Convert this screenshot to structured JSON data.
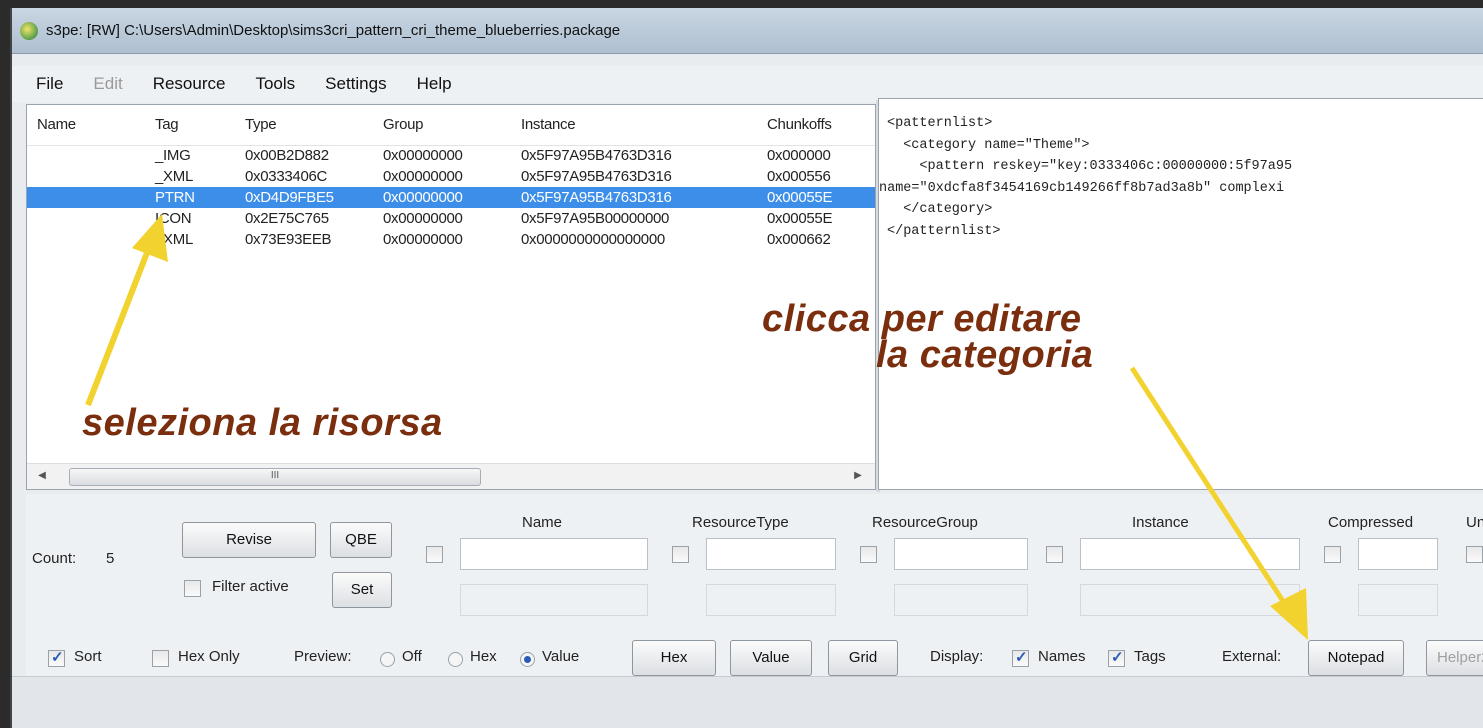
{
  "window": {
    "title": "s3pe: [RW] C:\\Users\\Admin\\Desktop\\sims3cri_pattern_cri_theme_blueberries.package"
  },
  "menu": [
    {
      "label": "File",
      "enabled": true
    },
    {
      "label": "Edit",
      "enabled": false
    },
    {
      "label": "Resource",
      "enabled": true
    },
    {
      "label": "Tools",
      "enabled": true
    },
    {
      "label": "Settings",
      "enabled": true
    },
    {
      "label": "Help",
      "enabled": true
    }
  ],
  "resources": {
    "columns": [
      "Name",
      "Tag",
      "Type",
      "Group",
      "Instance",
      "Chunkoffs"
    ],
    "rows": [
      {
        "name": "",
        "tag": "_IMG",
        "type": "0x00B2D882",
        "group": "0x00000000",
        "instance": "0x5F97A95B4763D316",
        "chunk": "0x000000",
        "selected": false
      },
      {
        "name": "",
        "tag": "_XML",
        "type": "0x0333406C",
        "group": "0x00000000",
        "instance": "0x5F97A95B4763D316",
        "chunk": "0x000556",
        "selected": false
      },
      {
        "name": "",
        "tag": "PTRN",
        "type": "0xD4D9FBE5",
        "group": "0x00000000",
        "instance": "0x5F97A95B4763D316",
        "chunk": "0x00055E",
        "selected": true
      },
      {
        "name": "",
        "tag": "ICON",
        "type": "0x2E75C765",
        "group": "0x00000000",
        "instance": "0x5F97A95B00000000",
        "chunk": "0x00055E",
        "selected": false
      },
      {
        "name": "",
        "tag": "_XML",
        "type": "0x73E93EEB",
        "group": "0x00000000",
        "instance": "0x0000000000000000",
        "chunk": "0x000662",
        "selected": false
      }
    ],
    "scroll_thumb_glyph": "III"
  },
  "preview": {
    "lines": [
      "<patternlist>",
      "  <category name=\"Theme\">",
      "    <pattern reskey=\"key:0333406c:00000000:5f97a95",
      "name=\"0xdcfa8f3454169cb149266ff8b7ad3a8b\" complexi",
      "  </category>",
      "</patternlist>"
    ]
  },
  "filter": {
    "count_label": "Count:",
    "count_value": "5",
    "revise": "Revise",
    "qbe": "QBE",
    "filter_active": "Filter active",
    "set": "Set",
    "fields": [
      "Name",
      "ResourceType",
      "ResourceGroup",
      "Instance",
      "Compressed",
      "Un"
    ]
  },
  "options": {
    "sort": "Sort",
    "hex_only": "Hex Only",
    "preview_label": "Preview:",
    "off": "Off",
    "hex": "Hex",
    "value": "Value",
    "btn_hex": "Hex",
    "btn_value": "Value",
    "btn_grid": "Grid",
    "display_label": "Display:",
    "names": "Names",
    "tags": "Tags",
    "external_label": "External:",
    "notepad": "Notepad",
    "helper": "Helper2"
  },
  "annotations": {
    "select_resource": "seleziona la risorsa",
    "edit_line1": "clicca per editare",
    "edit_line2": "la categoria"
  },
  "colors": {
    "selection": "#3d8ee9",
    "annotation_text": "#7a2e0e",
    "arrow": "#f2d22e"
  }
}
